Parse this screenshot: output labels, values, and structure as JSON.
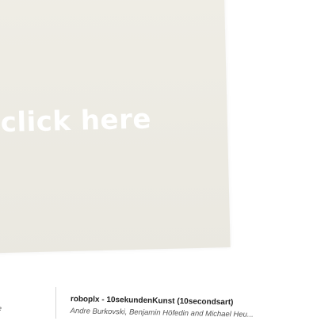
{
  "artwork": {
    "click_label": "click here"
  },
  "caption": {
    "left_fragment": "e",
    "title": "roboplx - 10sekundenKunst (10secondsart)",
    "authors": "Andre Burkovski, Benjamin Höfedin and Michael Heu..."
  }
}
